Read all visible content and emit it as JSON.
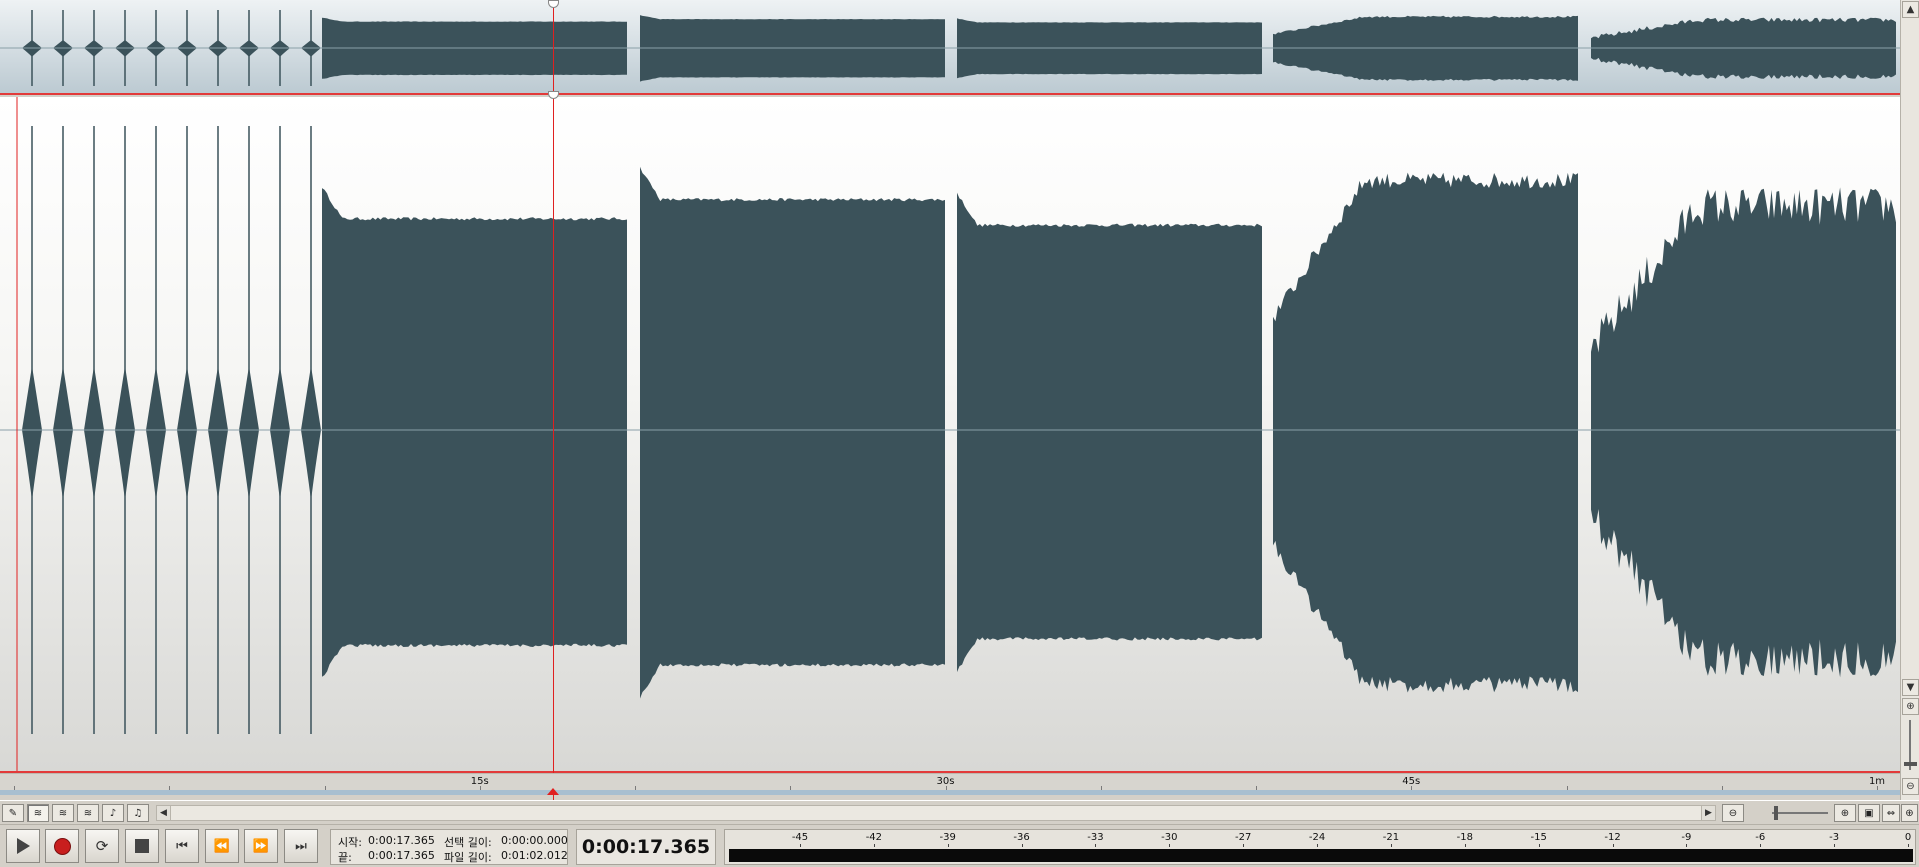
{
  "waveform": {
    "duration_seconds": 62.012,
    "playhead_seconds": 17.365,
    "wave_color": "#3b525a",
    "selection_color": "#e23a3a"
  },
  "ruler": {
    "labels": [
      {
        "t": 15,
        "text": "15s"
      },
      {
        "t": 30,
        "text": "30s"
      },
      {
        "t": 45,
        "text": "45s"
      },
      {
        "t": 60,
        "text": "1m"
      }
    ]
  },
  "tools": [
    {
      "name": "pencil-tool-icon",
      "glyph": "✎"
    },
    {
      "name": "select-waveform-tool-icon",
      "glyph": "≋"
    },
    {
      "name": "waveform-view-tool-icon",
      "glyph": "≋"
    },
    {
      "name": "spectral-view-tool-icon",
      "glyph": "≋"
    },
    {
      "name": "tuning-fork-tool-icon",
      "glyph": "♪"
    },
    {
      "name": "metronome-tool-icon",
      "glyph": "♫"
    }
  ],
  "transport": {
    "start_label": "시작:",
    "start_value": "0:00:17.365",
    "end_label": "끝:",
    "end_value": "0:00:17.365",
    "sel_len_label": "선택 길이:",
    "sel_len_value": "0:00:00.000",
    "file_len_label": "파일 길이:",
    "file_len_value": "0:01:02.012",
    "current_time": "0:00:17.365"
  },
  "meter": {
    "labels": [
      "-45",
      "-42",
      "-39",
      "-36",
      "-33",
      "-30",
      "-27",
      "-24",
      "-21",
      "-18",
      "-15",
      "-12",
      "-9",
      "-6",
      "-3",
      "0"
    ]
  }
}
